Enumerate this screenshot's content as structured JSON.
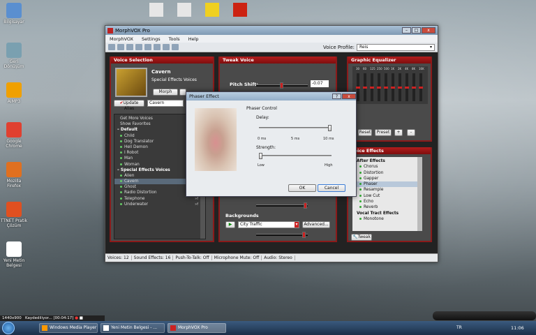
{
  "desktop_icons": [
    {
      "label": "Bilgisayar",
      "icon": "computer-icon",
      "color": "#5a8fd0"
    },
    {
      "label": "Geri Dönüşüm",
      "icon": "recycle-bin-icon",
      "color": "#7aa0b0"
    },
    {
      "label": "AIMP3",
      "icon": "aimp-icon",
      "color": "#f0a000"
    },
    {
      "label": "Google Chrome",
      "icon": "chrome-icon",
      "color": "#e04030"
    },
    {
      "label": "Mozilla Firefox",
      "icon": "firefox-icon",
      "color": "#e07020"
    },
    {
      "label": "TTNET Pratik Çözüm",
      "icon": "ttnet-icon",
      "color": "#e05020"
    },
    {
      "label": "Yeni Metin Belgesi",
      "icon": "text-document-icon",
      "color": "#ffffff"
    }
  ],
  "top_icons": [
    "doc-icon",
    "doc-icon",
    "zip-icon",
    "morphvox-icon"
  ],
  "app": {
    "title": "MorphVOX Pro",
    "menu": [
      "MorphVOX",
      "Settings",
      "Tools",
      "Help"
    ],
    "voice_profile_label": "Voice Profile:",
    "voice_profile_value": "Reis",
    "panels": {
      "voice_selection": "Voice Selection",
      "tweak_voice": "Tweak Voice",
      "graphic_equalizer": "Graphic Equalizer",
      "voice_effects": "Voice Effects"
    },
    "current_voice": {
      "name": "Cavern",
      "category": "Special Effects Voices"
    },
    "morph_button": "Morph",
    "update_alias_button": "Update Alias",
    "alias_value": "Cavern",
    "voice_list": [
      {
        "t": "Get More Voices",
        "type": "link"
      },
      {
        "t": "Show Favorites",
        "type": "link"
      },
      {
        "t": "Default",
        "type": "group"
      },
      {
        "t": "Child",
        "type": "item"
      },
      {
        "t": "Dog Translator",
        "type": "item"
      },
      {
        "t": "Hell Demon",
        "type": "item"
      },
      {
        "t": "I Robot",
        "type": "item"
      },
      {
        "t": "Man",
        "type": "item"
      },
      {
        "t": "Woman",
        "type": "item"
      },
      {
        "t": "Special Effects Voices",
        "type": "group"
      },
      {
        "t": "Alien",
        "type": "item"
      },
      {
        "t": "Cavern",
        "type": "item",
        "selected": true
      },
      {
        "t": "Ghost",
        "type": "item",
        "flag": "eff"
      },
      {
        "t": "Radio Distortion",
        "type": "item",
        "flag": "eff"
      },
      {
        "t": "Telephone",
        "type": "item",
        "flag": "eff"
      },
      {
        "t": "Underwater",
        "type": "item",
        "flag": "eff"
      }
    ],
    "pitch_shift_label": "Pitch Shift:",
    "pitch_shift_value": "-0.07",
    "backgrounds_label": "Backgrounds",
    "background_value": "City Traffic",
    "advanced_button": "Advanced...",
    "eq_bands": [
      "30",
      "60",
      "125",
      "250",
      "500",
      "1K",
      "2K",
      "4K",
      "8K",
      "16K"
    ],
    "eq_levels": [
      0.5,
      0.5,
      0.5,
      0.5,
      0.5,
      0.5,
      0.5,
      0.5,
      0.5,
      0.5
    ],
    "reset_button": "Reset",
    "preset_button": "Preset",
    "plus_button": "+",
    "minus_button": "-",
    "effects_list": [
      {
        "t": "After Effects",
        "type": "group"
      },
      {
        "t": "Chorus"
      },
      {
        "t": "Distortion"
      },
      {
        "t": "Gapper"
      },
      {
        "t": "Phaser",
        "selected": true
      },
      {
        "t": "Resample"
      },
      {
        "t": "Low Cut"
      },
      {
        "t": "Echo"
      },
      {
        "t": "Reverb"
      },
      {
        "t": "Vocal Tract Effects",
        "type": "group"
      },
      {
        "t": "Monotone"
      }
    ],
    "tweak_button": "Tweak",
    "status": [
      "Voices: 12",
      "Sound Effects: 16",
      "Push-To-Talk: Off",
      "Microphone Mute: Off",
      "Audio: Stereo"
    ]
  },
  "dialog": {
    "title": "Phaser Effect",
    "group": "Phaser Control",
    "delay_label": "Delay:",
    "delay_ticks": [
      "0 ms",
      "5 ms",
      "10 ms"
    ],
    "delay_value": 1.0,
    "strength_label": "Strength:",
    "strength_ticks": [
      "Low",
      "High"
    ],
    "strength_value": 0.0,
    "ok": "OK",
    "cancel": "Cancel"
  },
  "mini_status": "Kaydediliyor... [00:04:17]",
  "resolution": "1440x900",
  "taskbar": {
    "buttons": [
      "Windows Media Player",
      "Yeni Metin Belgesi - ...",
      "MorphVOX Pro"
    ],
    "lang": "TR",
    "clock": "11:06"
  }
}
